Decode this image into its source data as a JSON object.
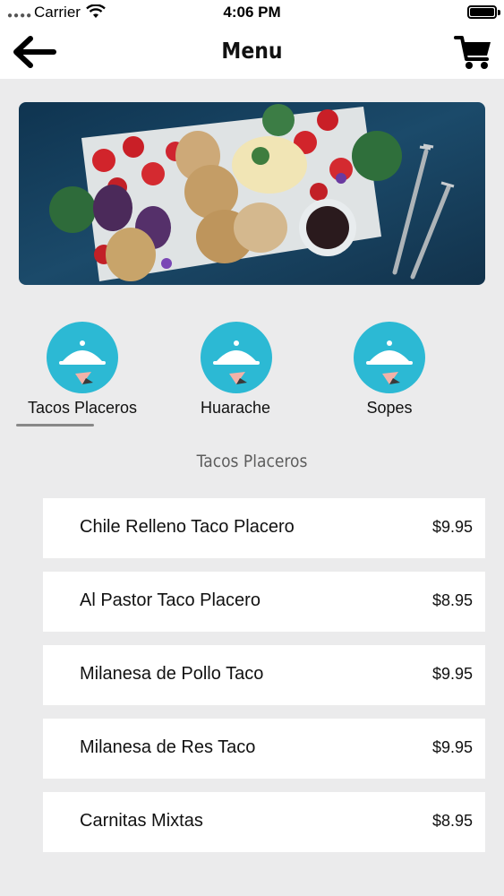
{
  "status_bar": {
    "carrier": "Carrier",
    "time": "4:06 PM"
  },
  "nav": {
    "title": "Menu",
    "back_icon": "arrow-left-icon",
    "cart_icon": "shopping-cart-icon"
  },
  "hero": {
    "alt": "food platter"
  },
  "categories": [
    {
      "label": "Tacos Placeros",
      "icon": "serving-cloche-icon",
      "selected": true
    },
    {
      "label": "Huarache",
      "icon": "serving-cloche-icon",
      "selected": false
    },
    {
      "label": "Sopes",
      "icon": "serving-cloche-icon",
      "selected": false
    }
  ],
  "section_title": "Tacos Placeros",
  "menu_items": [
    {
      "name": "Chile Relleno Taco Placero",
      "price": "$9.95"
    },
    {
      "name": "Al Pastor Taco Placero",
      "price": "$8.95"
    },
    {
      "name": "Milanesa de Pollo Taco",
      "price": "$9.95"
    },
    {
      "name": "Milanesa de Res Taco",
      "price": "$9.95"
    },
    {
      "name": "Carnitas Mixtas",
      "price": "$8.95"
    }
  ],
  "colors": {
    "accent": "#2cb9d4",
    "background": "#ebebec",
    "card": "#ffffff"
  }
}
